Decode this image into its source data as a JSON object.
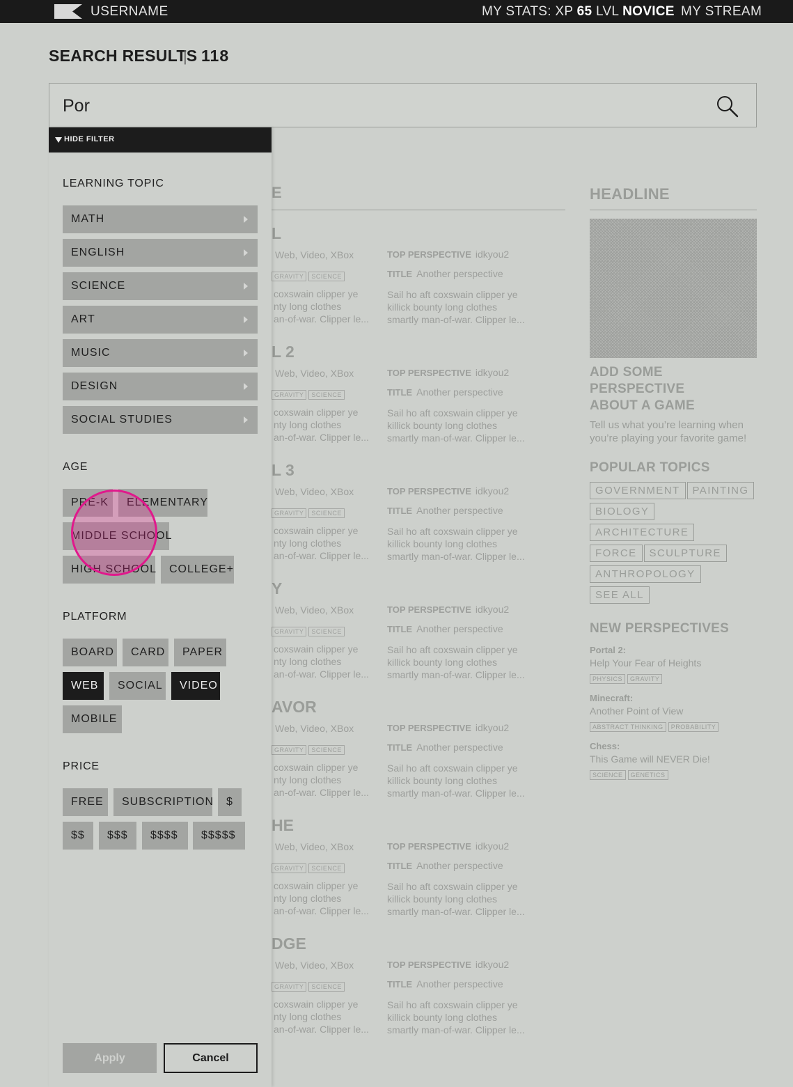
{
  "topbar": {
    "username": "USERNAME",
    "stats_prefix": "MY STATS: XP",
    "xp": "65",
    "lvl_label": "LVL",
    "level": "NOVICE",
    "stream": "MY STREAM"
  },
  "header": {
    "title": "SEARCH RESULTS",
    "separator": "|",
    "count": "118"
  },
  "search": {
    "value": "Por"
  },
  "filter": {
    "toggle_label": "HIDE FILTER",
    "topic_label": "LEARNING TOPIC",
    "topics": [
      "MATH",
      "ENGLISH",
      "SCIENCE",
      "ART",
      "MUSIC",
      "DESIGN",
      "SOCIAL STUDIES"
    ],
    "age_label": "AGE",
    "ages": [
      "PRE-K",
      "ELEMENTARY",
      "MIDDLE SCHOOL",
      "HIGH SCHOOL",
      "COLLEGE+"
    ],
    "platform_label": "PLATFORM",
    "platforms": [
      "BOARD",
      "CARD",
      "PAPER",
      "WEB",
      "SOCIAL",
      "VIDEO",
      "MOBILE"
    ],
    "price_label": "PRICE",
    "prices": [
      "FREE",
      "SUBSCRIPTION",
      "$",
      "$$",
      "$$$",
      "$$$$",
      "$$$$$"
    ],
    "apply_label": "Apply",
    "cancel_label": "Cancel"
  },
  "results": {
    "heading": "E",
    "games": [
      {
        "title": "L",
        "platforms": "Web, Video, XBox",
        "tag1": "GRAVITY",
        "tag2": "SCIENCE",
        "desc1": "coxswain clipper ye",
        "desc2": "nty long clothes",
        "desc3": "an-of-war. Clipper le...",
        "persp_label": "TOP PERSPECTIVE",
        "persp_user": "idkyou2",
        "title_label": "TITLE",
        "persp_title": "Another perspective",
        "pdesc1": "Sail ho aft coxswain clipper ye",
        "pdesc2": "killick bounty long clothes",
        "pdesc3": "smartly man-of-war. Clipper le..."
      },
      {
        "title": "L 2",
        "platforms": "Web, Video, XBox",
        "tag1": "GRAVITY",
        "tag2": "SCIENCE",
        "desc1": "coxswain clipper ye",
        "desc2": "nty long clothes",
        "desc3": "an-of-war. Clipper le...",
        "persp_label": "TOP PERSPECTIVE",
        "persp_user": "idkyou2",
        "title_label": "TITLE",
        "persp_title": "Another perspective",
        "pdesc1": "Sail ho aft coxswain clipper ye",
        "pdesc2": "killick bounty long clothes",
        "pdesc3": "smartly man-of-war. Clipper le..."
      },
      {
        "title": "L 3",
        "platforms": "Web, Video, XBox",
        "tag1": "GRAVITY",
        "tag2": "SCIENCE",
        "desc1": "coxswain clipper ye",
        "desc2": "nty long clothes",
        "desc3": "an-of-war. Clipper le...",
        "persp_label": "TOP PERSPECTIVE",
        "persp_user": "idkyou2",
        "title_label": "TITLE",
        "persp_title": "Another perspective",
        "pdesc1": "Sail ho aft coxswain clipper ye",
        "pdesc2": "killick bounty long clothes",
        "pdesc3": "smartly man-of-war. Clipper le..."
      },
      {
        "title": "Y",
        "platforms": "Web, Video, XBox",
        "tag1": "GRAVITY",
        "tag2": "SCIENCE",
        "desc1": "coxswain clipper ye",
        "desc2": "nty long clothes",
        "desc3": "an-of-war. Clipper le...",
        "persp_label": "TOP PERSPECTIVE",
        "persp_user": "idkyou2",
        "title_label": "TITLE",
        "persp_title": "Another perspective",
        "pdesc1": "Sail ho aft coxswain clipper ye",
        "pdesc2": "killick bounty long clothes",
        "pdesc3": "smartly man-of-war. Clipper le..."
      },
      {
        "title": "AVOR",
        "platforms": "Web, Video, XBox",
        "tag1": "GRAVITY",
        "tag2": "SCIENCE",
        "desc1": "coxswain clipper ye",
        "desc2": "nty long clothes",
        "desc3": "an-of-war. Clipper le...",
        "persp_label": "TOP PERSPECTIVE",
        "persp_user": "idkyou2",
        "title_label": "TITLE",
        "persp_title": "Another perspective",
        "pdesc1": "Sail ho aft coxswain clipper ye",
        "pdesc2": "killick bounty long clothes",
        "pdesc3": "smartly man-of-war. Clipper le..."
      },
      {
        "title": "HE",
        "platforms": "Web, Video, XBox",
        "tag1": "GRAVITY",
        "tag2": "SCIENCE",
        "desc1": "coxswain clipper ye",
        "desc2": "nty long clothes",
        "desc3": "an-of-war. Clipper le...",
        "persp_label": "TOP PERSPECTIVE",
        "persp_user": "idkyou2",
        "title_label": "TITLE",
        "persp_title": "Another perspective",
        "pdesc1": "Sail ho aft coxswain clipper ye",
        "pdesc2": "killick bounty long clothes",
        "pdesc3": "smartly man-of-war. Clipper le..."
      },
      {
        "title": "DGE",
        "platforms": "Web, Video, XBox",
        "tag1": "GRAVITY",
        "tag2": "SCIENCE",
        "desc1": "coxswain clipper ye",
        "desc2": "nty long clothes",
        "desc3": "an-of-war. Clipper le...",
        "persp_label": "TOP PERSPECTIVE",
        "persp_user": "idkyou2",
        "title_label": "TITLE",
        "persp_title": "Another perspective",
        "pdesc1": "Sail ho aft coxswain clipper ye",
        "pdesc2": "killick bounty long clothes",
        "pdesc3": "smartly man-of-war. Clipper le..."
      }
    ]
  },
  "sidebar": {
    "headline": "HEADLINE",
    "cta_title_1": "ADD SOME PERSPECTIVE",
    "cta_title_2": "ABOUT A GAME",
    "cta_text_1": "Tell us what you’re learning when",
    "cta_text_2": "you’re playing your favorite game!",
    "popular_title": "POPULAR TOPICS",
    "popular_topics": [
      "GOVERNMENT",
      "PAINTING",
      "BIOLOGY",
      "ARCHITECTURE",
      "FORCE",
      "SCULPTURE",
      "ANTHROPOLOGY",
      "SEE ALL"
    ],
    "new_title": "NEW PERSPECTIVES",
    "new_perspectives": [
      {
        "game": "Portal 2:",
        "title": "Help Your Fear of Heights",
        "tag1": "PHYSICS",
        "tag2": "GRAVITY"
      },
      {
        "game": "Minecraft:",
        "title": "Another Point of View",
        "tag1": "ABSTRACT THINKING",
        "tag2": "PROBABILITY"
      },
      {
        "game": "Chess:",
        "title": "This Game will NEVER Die!",
        "tag1": "SCIENCE",
        "tag2": "GENETICS"
      }
    ]
  },
  "colors": {
    "background": "#cdd0cc",
    "topbar": "#1a1a1a",
    "chip": "#a3a5a2",
    "chip_selected": "#1c1c1c",
    "touch_indicator": "#e0198c"
  }
}
